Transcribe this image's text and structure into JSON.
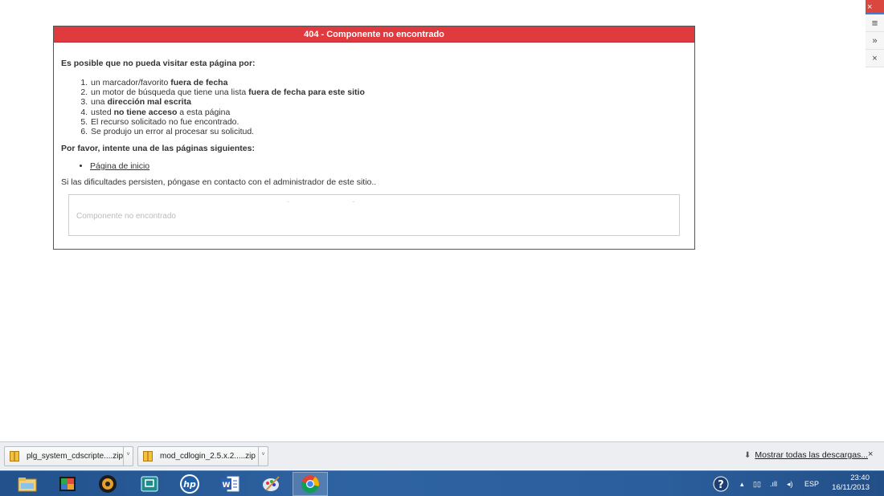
{
  "error": {
    "title": "404 - Componente no encontrado",
    "intro": "Es posible que no pueda visitar esta página por:",
    "reasons": [
      {
        "pre": "un marcador/favorito ",
        "bold": "fuera de fecha",
        "post": ""
      },
      {
        "pre": "un motor de búsqueda que tiene una lista ",
        "bold": "fuera de fecha para este sitio",
        "post": ""
      },
      {
        "pre": "una ",
        "bold": "dirección mal escrita",
        "post": ""
      },
      {
        "pre": "usted ",
        "bold": "no tiene acceso",
        "post": " a esta página"
      },
      {
        "pre": "El recurso solicitado no fue encontrado.",
        "bold": "",
        "post": ""
      },
      {
        "pre": "Se produjo un error al procesar su solicitud.",
        "bold": "",
        "post": ""
      }
    ],
    "retry": "Por favor, intente una de las páginas siguientes:",
    "home_link": "Página de inicio",
    "contact": "Si las dificultades persisten, póngase en contacto con el administrador de este sitio..",
    "message": "Componente no encontrado"
  },
  "side_controls": {
    "close": "×",
    "menu": "≡",
    "more": "»",
    "dismiss": "×"
  },
  "downloads": {
    "items": [
      {
        "name": "plg_system_cdscripte....zip"
      },
      {
        "name": "mod_cdlogin_2.5.x.2.....zip"
      }
    ],
    "show_all": "Mostrar todas las descargas...",
    "close": "×"
  },
  "taskbar": {
    "apps": [
      "file-explorer",
      "media-app",
      "webcam-app",
      "remote-app",
      "hp-app",
      "word",
      "paint",
      "chrome"
    ],
    "language": "ESP",
    "time": "23:40",
    "date": "16/11/2013"
  },
  "colors": {
    "error_header": "#e0393e",
    "taskbar": "#2e63a2"
  }
}
